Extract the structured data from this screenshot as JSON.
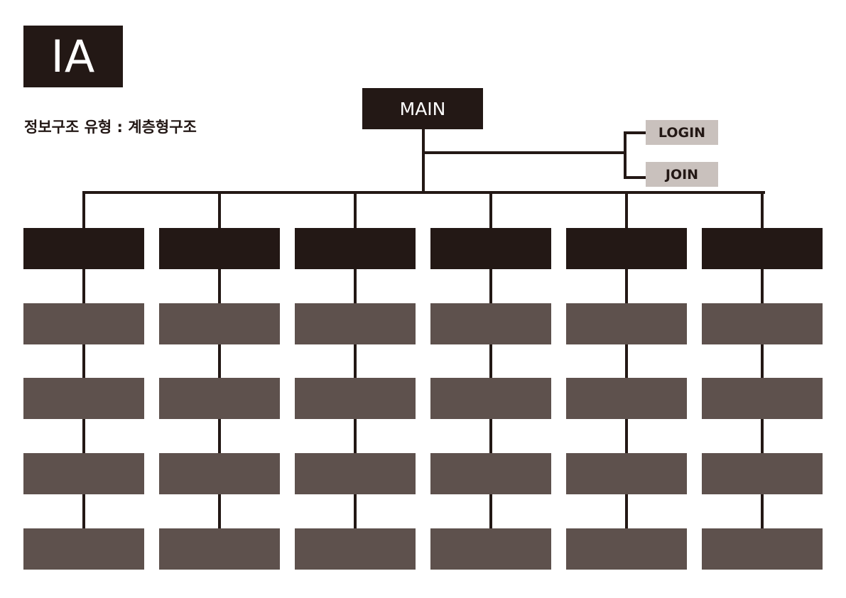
{
  "header": {
    "title": "IA",
    "subtitle": "정보구조 유형 : 계층형구조"
  },
  "diagram": {
    "root": {
      "label": "MAIN"
    },
    "side_nodes": [
      {
        "label": "LOGIN"
      },
      {
        "label": "JOIN"
      }
    ],
    "category_count": 6,
    "sub_levels": 4
  },
  "colors": {
    "dark": "#231815",
    "sub_node": "#5e514d",
    "side_node": "#c9c1bd",
    "line": "#231815"
  }
}
